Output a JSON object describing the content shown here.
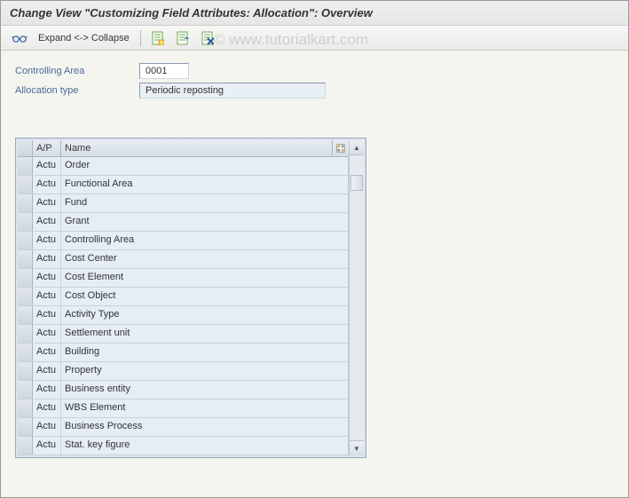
{
  "title": "Change View \"Customizing Field Attributes: Allocation\": Overview",
  "watermark": "© www.tutorialkart.com",
  "toolbar": {
    "expand_collapse": "Expand <-> Collapse"
  },
  "form": {
    "controlling_area_label": "Controlling Area",
    "controlling_area_value": "0001",
    "allocation_type_label": "Allocation type",
    "allocation_type_value": "Periodic reposting"
  },
  "table": {
    "headers": {
      "ap": "A/P",
      "name": "Name"
    },
    "rows": [
      {
        "ap": "Actu",
        "name": "Order"
      },
      {
        "ap": "Actu",
        "name": "Functional Area"
      },
      {
        "ap": "Actu",
        "name": "Fund"
      },
      {
        "ap": "Actu",
        "name": "Grant"
      },
      {
        "ap": "Actu",
        "name": "Controlling Area"
      },
      {
        "ap": "Actu",
        "name": "Cost Center"
      },
      {
        "ap": "Actu",
        "name": "Cost Element"
      },
      {
        "ap": "Actu",
        "name": "Cost Object"
      },
      {
        "ap": "Actu",
        "name": "Activity Type"
      },
      {
        "ap": "Actu",
        "name": "Settlement unit"
      },
      {
        "ap": "Actu",
        "name": "Building"
      },
      {
        "ap": "Actu",
        "name": "Property"
      },
      {
        "ap": "Actu",
        "name": "Business entity"
      },
      {
        "ap": "Actu",
        "name": "WBS Element"
      },
      {
        "ap": "Actu",
        "name": "Business Process"
      },
      {
        "ap": "Actu",
        "name": "Stat. key figure"
      }
    ]
  }
}
